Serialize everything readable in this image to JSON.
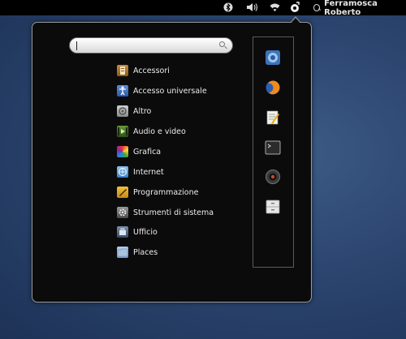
{
  "topbar": {
    "user_name": "Ferramosca Roberto",
    "icons": [
      "bluetooth-icon",
      "volume-icon",
      "wifi-icon",
      "applications-icon"
    ]
  },
  "search": {
    "value": "",
    "placeholder": ""
  },
  "categories": [
    {
      "label": "Accessori",
      "icon": "accessories-icon"
    },
    {
      "label": "Accesso universale",
      "icon": "universal-access-icon"
    },
    {
      "label": "Altro",
      "icon": "other-icon"
    },
    {
      "label": "Audio e video",
      "icon": "audio-video-icon"
    },
    {
      "label": "Grafica",
      "icon": "graphics-icon"
    },
    {
      "label": "Internet",
      "icon": "internet-icon"
    },
    {
      "label": "Programmazione",
      "icon": "programming-icon"
    },
    {
      "label": "Strumenti di sistema",
      "icon": "system-tools-icon"
    },
    {
      "label": "Ufficio",
      "icon": "office-icon"
    },
    {
      "label": "Places",
      "icon": "folder-icon"
    }
  ],
  "favorites": [
    "chromium-icon",
    "firefox-icon",
    "text-editor-icon",
    "terminal-icon",
    "webcam-icon",
    "file-cabinet-icon"
  ],
  "colors": {
    "panel_bg": "#0b0b0c",
    "topbar_bg": "#000000",
    "desktop": "#2c4670"
  }
}
